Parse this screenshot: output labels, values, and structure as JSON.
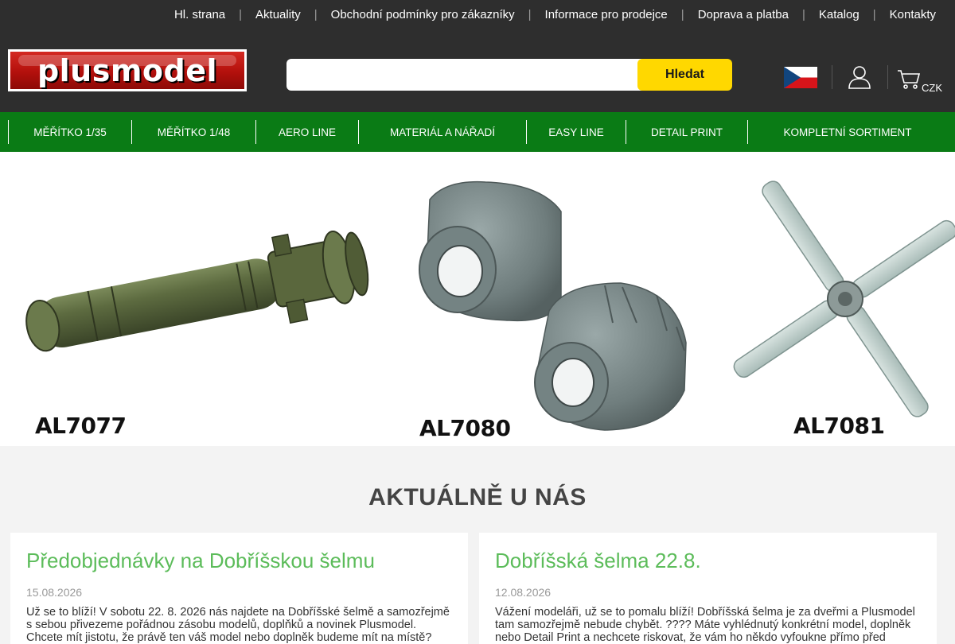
{
  "topnav": {
    "items": [
      "Hl. strana",
      "Aktuality",
      "Obchodní podmínky pro zákazníky",
      "Informace pro prodejce",
      "Doprava a platba",
      "Katalog",
      "Kontakty"
    ],
    "separator": "|"
  },
  "header": {
    "logo_text": "plusmodel",
    "search_placeholder": "",
    "search_button": "Hledat",
    "currency": "CZK",
    "language_flag": "cz-flag-icon",
    "user_icon": "user-icon",
    "cart_icon": "cart-icon"
  },
  "catnav": {
    "items": [
      "MĚŘÍTKO 1/35",
      "MĚŘÍTKO 1/48",
      "AERO LINE",
      "MATERIÁL A NÁŘADÍ",
      "EASY LINE",
      "DETAIL PRINT",
      "KOMPLETNÍ SORTIMENT"
    ]
  },
  "hero": {
    "products": [
      {
        "code": "AL7077"
      },
      {
        "code": "AL7080"
      },
      {
        "code": "AL7081"
      }
    ]
  },
  "news": {
    "title": "AKTUÁLNĚ U NÁS",
    "cards": [
      {
        "title": "Předobjednávky na Dobříšskou šelmu",
        "date": "15.08.2026",
        "text": "Už se to blíží! V sobotu 22. 8. 2026 nás najdete na Dobříšské šelmě a samozřejmě s sebou přivezeme pořádnou zásobu modelů, doplňků a novinek Plusmodel. Chcete mít jistotu, že právě ten váš model nebo doplněk budeme mít na místě? Neopakujte se..."
      },
      {
        "title": "Dobříšská šelma 22.8.",
        "date": "12.08.2026",
        "text": "Vážení modeláři, už se to pomalu blíží! Dobříšská šelma je za dveřmi a Plusmodel tam samozřejmě nebude chybět. ???? Máte vyhlédnutý konkrétní model, doplněk nebo Detail Print a nechcete riskovat, že vám ho někdo vyfoukne přímo před nosem?"
      }
    ]
  },
  "colors": {
    "dark_bg": "#2e2e2e",
    "green_nav": "#0a7b15",
    "yellow_button": "#ffd800",
    "news_title_green": "#5cbc5a"
  }
}
